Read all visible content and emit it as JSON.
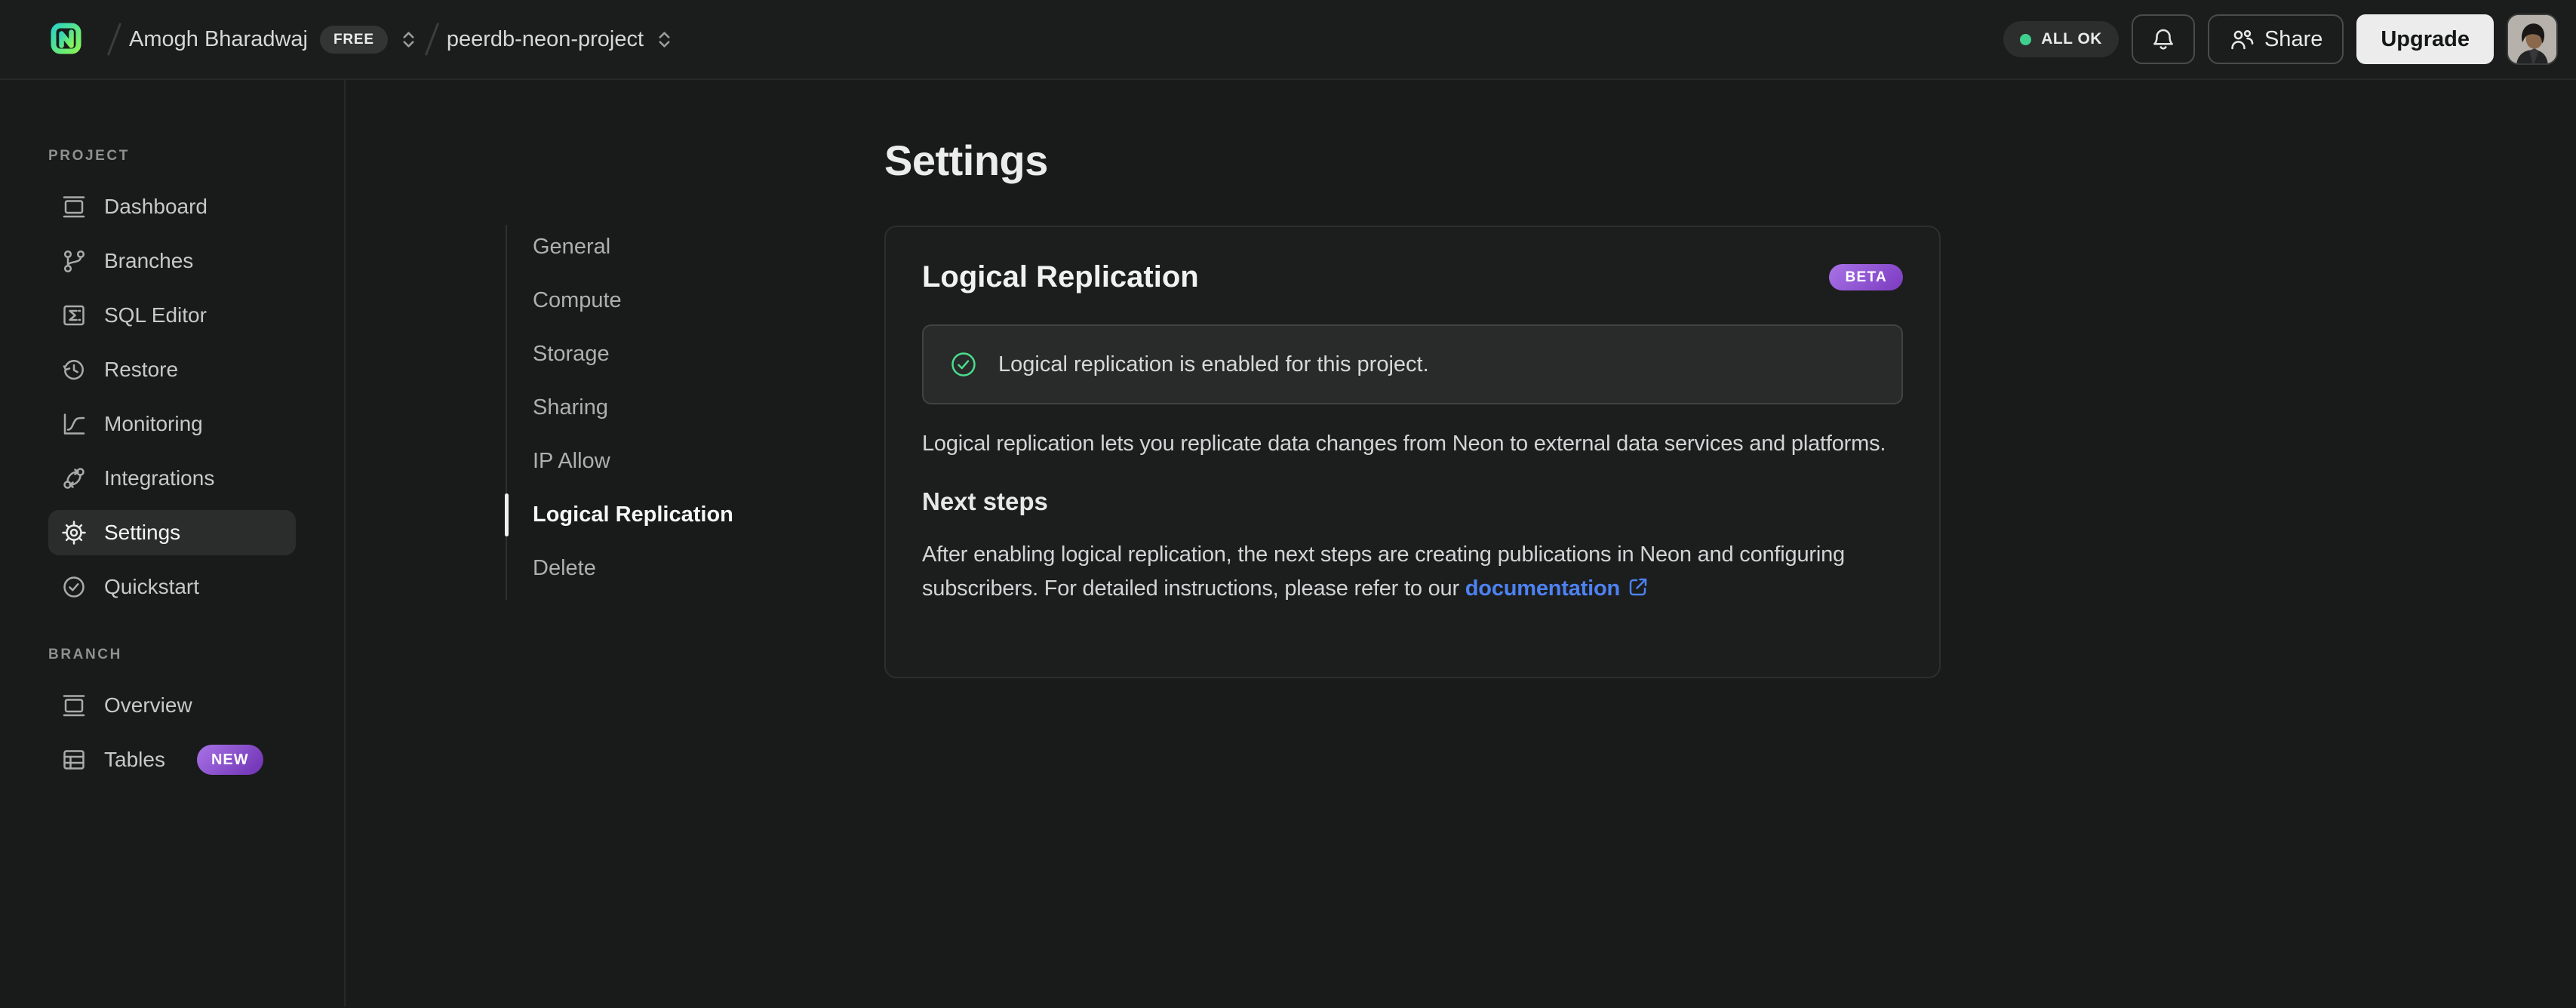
{
  "topbar": {
    "logo_icon": "neon-logo",
    "breadcrumb": {
      "org_name": "Amogh Bharadwaj",
      "org_plan_badge": "FREE",
      "project_name": "peerdb-neon-project"
    },
    "status": {
      "label": "ALL OK",
      "dot_color": "#3fd08f"
    },
    "notifications_icon": "bell-icon",
    "share_label": "Share",
    "upgrade_label": "Upgrade",
    "avatar": "user-profile-photo"
  },
  "sidebar": {
    "sections": [
      {
        "label": "PROJECT",
        "items": [
          {
            "label": "Dashboard",
            "icon": "window-icon"
          },
          {
            "label": "Branches",
            "icon": "git-branch-icon"
          },
          {
            "label": "SQL Editor",
            "icon": "sql-terminal-icon"
          },
          {
            "label": "Restore",
            "icon": "history-clock-icon"
          },
          {
            "label": "Monitoring",
            "icon": "chart-curve-icon"
          },
          {
            "label": "Integrations",
            "icon": "workflow-arrows-icon"
          },
          {
            "label": "Settings",
            "icon": "gear-icon",
            "active": true
          },
          {
            "label": "Quickstart",
            "icon": "check-circle-icon"
          }
        ]
      },
      {
        "label": "BRANCH",
        "items": [
          {
            "label": "Overview",
            "icon": "window-icon"
          },
          {
            "label": "Tables",
            "icon": "table-icon",
            "badge": "NEW"
          }
        ]
      }
    ]
  },
  "settings_nav": {
    "items": [
      {
        "label": "General"
      },
      {
        "label": "Compute"
      },
      {
        "label": "Storage"
      },
      {
        "label": "Sharing"
      },
      {
        "label": "IP Allow"
      },
      {
        "label": "Logical Replication",
        "active": true
      },
      {
        "label": "Delete"
      }
    ],
    "active_item": "Logical Replication"
  },
  "main": {
    "page_title": "Settings",
    "card": {
      "title": "Logical Replication",
      "badge": "BETA",
      "alert_text": "Logical replication is enabled for this project.",
      "description": "Logical replication lets you replicate data changes from Neon to external data services and platforms.",
      "subheading": "Next steps",
      "next_text_before_link": "After enabling logical replication, the next steps are creating publications in Neon and configuring subscribers. For detailed instructions, please refer to our ",
      "link_label": "documentation",
      "link_icon": "external-link-icon"
    }
  },
  "colors": {
    "page_background": "#191a1a",
    "card_background": "#1c1d1d",
    "alert_background": "#292a2a",
    "accent_green": "#3fd08f",
    "badge_purple_from": "#a873e6",
    "badge_purple_to": "#7b3ac0",
    "link_blue": "#4d82f2",
    "logo_gradient_from": "#2dd4bf",
    "logo_gradient_to": "#84f557"
  }
}
